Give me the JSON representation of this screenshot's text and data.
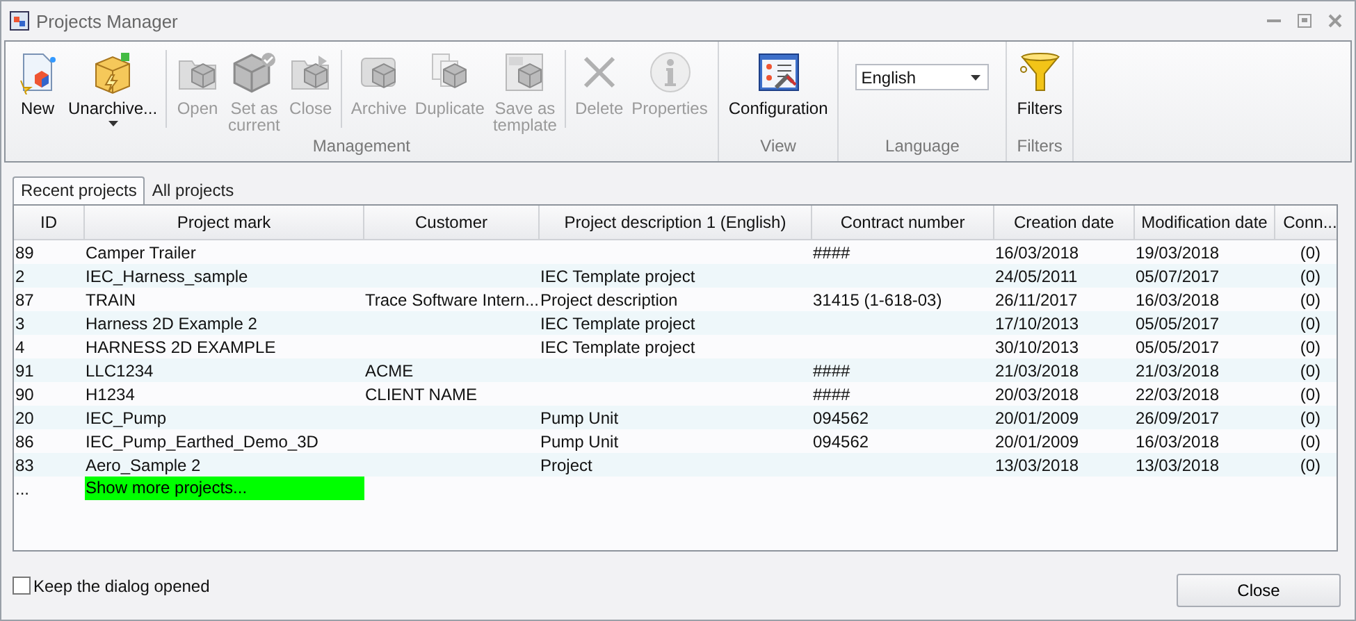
{
  "window": {
    "title": "Projects Manager"
  },
  "ribbon": {
    "groups": [
      {
        "label": "Management",
        "kind": "buttons",
        "sections": [
          [
            {
              "label": "New",
              "disabled": false
            },
            {
              "label": "Unarchive...",
              "disabled": false,
              "menu": true
            }
          ],
          [
            {
              "label": "Open",
              "disabled": true
            },
            {
              "label": "Set as\ncurrent",
              "disabled": true
            },
            {
              "label": "Close",
              "disabled": true
            }
          ],
          [
            {
              "label": "Archive",
              "disabled": true
            },
            {
              "label": "Duplicate",
              "disabled": true
            },
            {
              "label": "Save as\ntemplate",
              "disabled": true
            }
          ],
          [
            {
              "label": "Delete",
              "disabled": true
            },
            {
              "label": "Properties",
              "disabled": true
            }
          ]
        ]
      },
      {
        "label": "View",
        "kind": "buttons",
        "sections": [
          [
            {
              "label": "Configuration",
              "disabled": false
            }
          ]
        ]
      },
      {
        "label": "Language",
        "kind": "dropdown",
        "value": "English"
      },
      {
        "label": "Filters",
        "kind": "buttons",
        "sections": [
          [
            {
              "label": "Filters",
              "disabled": false
            }
          ]
        ]
      }
    ]
  },
  "tabs": [
    {
      "label": "Recent projects",
      "selected": true
    },
    {
      "label": "All projects",
      "selected": false
    }
  ],
  "table": {
    "columns": [
      {
        "label": "ID"
      },
      {
        "label": "Project mark"
      },
      {
        "label": "Customer"
      },
      {
        "label": "Project description 1 (English)"
      },
      {
        "label": "Contract number"
      },
      {
        "label": "Creation date"
      },
      {
        "label": "Modification date"
      },
      {
        "label": "Conn..."
      }
    ],
    "rows": [
      {
        "kind": "project",
        "id": "89",
        "mark": "Camper Trailer",
        "contract": "####",
        "created": "16/03/2018",
        "modified": "19/03/2018",
        "conn": "(0)"
      },
      {
        "kind": "project",
        "id": "2",
        "mark": "IEC_Harness_sample",
        "description": "IEC Template project",
        "created": "24/05/2011",
        "modified": "05/07/2017",
        "conn": "(0)"
      },
      {
        "kind": "project",
        "id": "87",
        "mark": "TRAIN",
        "customer": "Trace Software Intern...",
        "description": "Project description",
        "contract": "31415 (1-618-03)",
        "created": "26/11/2017",
        "modified": "16/03/2018",
        "conn": "(0)"
      },
      {
        "kind": "project",
        "id": "3",
        "mark": "Harness 2D Example 2",
        "description": "IEC Template project",
        "created": "17/10/2013",
        "modified": "05/05/2017",
        "conn": "(0)"
      },
      {
        "kind": "project",
        "id": "4",
        "mark": "HARNESS 2D EXAMPLE",
        "description": "IEC Template project",
        "created": "30/10/2013",
        "modified": "05/05/2017",
        "conn": "(0)"
      },
      {
        "kind": "project",
        "id": "91",
        "mark": "LLC1234",
        "customer": "ACME",
        "contract": "####",
        "created": "21/03/2018",
        "modified": "21/03/2018",
        "conn": "(0)"
      },
      {
        "kind": "project",
        "id": "90",
        "mark": "H1234",
        "customer": "CLIENT NAME",
        "contract": "####",
        "created": "20/03/2018",
        "modified": "22/03/2018",
        "conn": "(0)"
      },
      {
        "kind": "project",
        "id": "20",
        "mark": "IEC_Pump",
        "description": "Pump Unit",
        "contract": "094562",
        "created": "20/01/2009",
        "modified": "26/09/2017",
        "conn": "(0)"
      },
      {
        "kind": "project",
        "id": "86",
        "mark": "IEC_Pump_Earthed_Demo_3D",
        "description": "Pump Unit",
        "contract": "094562",
        "created": "20/01/2009",
        "modified": "16/03/2018",
        "conn": "(0)"
      },
      {
        "kind": "project",
        "id": "83",
        "mark": "Aero_Sample 2",
        "description": "Project",
        "created": "13/03/2018",
        "modified": "13/03/2018",
        "conn": "(0)"
      },
      {
        "kind": "more",
        "id": "...",
        "mark": "Show more projects..."
      }
    ]
  },
  "footer": {
    "keep_open": {
      "label": "Keep the dialog opened",
      "checked": false
    },
    "buttons": [
      "Close"
    ]
  }
}
